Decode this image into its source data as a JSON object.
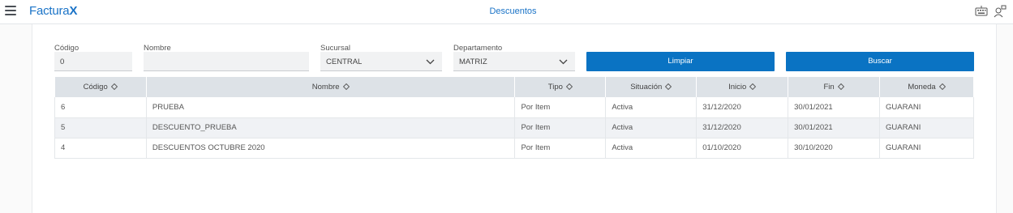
{
  "app": {
    "logo_text": "Factura",
    "logo_x": "X",
    "title": "Descuentos"
  },
  "filters": {
    "codigo_label": "Código",
    "codigo_value": "0",
    "nombre_label": "Nombre",
    "nombre_value": "",
    "sucursal_label": "Sucursal",
    "sucursal_value": "CENTRAL",
    "departamento_label": "Departamento",
    "departamento_value": "MATRIZ",
    "limpiar_label": "Limpiar",
    "buscar_label": "Buscar"
  },
  "table": {
    "headers": [
      "Código",
      "Nombre",
      "Tipo",
      "Situación",
      "Inicio",
      "Fin",
      "Moneda"
    ],
    "rows": [
      [
        "6",
        "PRUEBA",
        "Por Item",
        "Activa",
        "31/12/2020",
        "30/01/2021",
        "GUARANI"
      ],
      [
        "5",
        "DESCUENTO_PRUEBA",
        "Por Item",
        "Activa",
        "31/12/2020",
        "30/01/2021",
        "GUARANI"
      ],
      [
        "4",
        "DESCUENTOS OCTUBRE 2020",
        "Por Item",
        "Activa",
        "01/10/2020",
        "30/10/2020",
        "GUARANI"
      ]
    ]
  },
  "colors": {
    "accent": "#0a73c3",
    "header_bg": "#dde2e7"
  }
}
